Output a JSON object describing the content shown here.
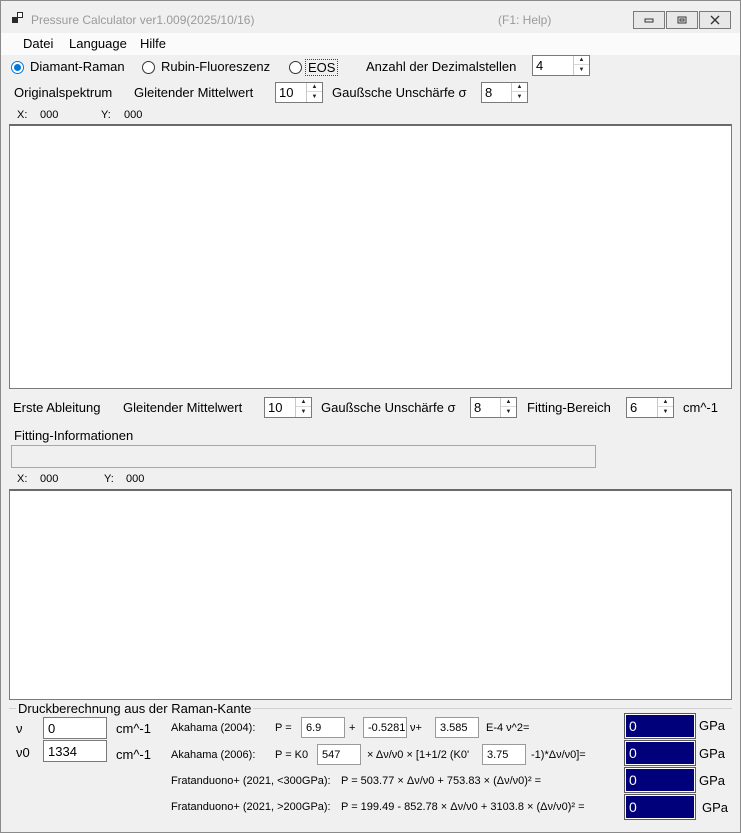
{
  "window": {
    "title": "Pressure Calculator  ver1.009(2025/10/16)",
    "help_hint": "(F1: Help)"
  },
  "menu": {
    "items": [
      "Datei",
      "Language",
      "Hilfe"
    ]
  },
  "mode": {
    "options": [
      "Diamant-Raman",
      "Rubin-Fluoreszenz",
      "EOS"
    ],
    "selected": "Diamant-Raman",
    "decimals_label": "Anzahl der Dezimalstellen",
    "decimals_value": "4"
  },
  "original": {
    "label": "Originalspektrum",
    "moving_avg_label": "Gleitender Mittelwert",
    "moving_avg_value": "10",
    "gauss_label": "Gaußsche Unschärfe σ",
    "gauss_value": "8",
    "x_label": "X:",
    "x_value": "000",
    "y_label": "Y:",
    "y_value": "000"
  },
  "derivative": {
    "label": "Erste Ableitung",
    "moving_avg_label": "Gleitender Mittelwert",
    "moving_avg_value": "10",
    "gauss_label": "Gaußsche Unschärfe σ",
    "gauss_value": "8",
    "fit_range_label": "Fitting-Bereich",
    "fit_range_value": "6",
    "fit_range_unit": "cm^-1",
    "fit_info_label": "Fitting-Informationen",
    "fit_info_value": "",
    "x_label": "X:",
    "x_value": "000",
    "y_label": "Y:",
    "y_value": "000"
  },
  "pressure": {
    "group_title": "Druckberechnung aus der Raman-Kante",
    "nu_label": "ν",
    "nu_value": "0",
    "nu_unit": "cm^-1",
    "nu0_label": "ν0",
    "nu0_value": "1334",
    "nu0_unit": "cm^-1",
    "akahama2004": {
      "name": "Akahama (2004):",
      "p_eq": "P =",
      "a": "6.9",
      "plus1": "+",
      "b": "-0.5281",
      "nu_plus": "ν+",
      "c": "3.585",
      "tail": "E-4 ν^2=",
      "result": "0",
      "unit": "GPa"
    },
    "akahama2006": {
      "name": "Akahama (2006):",
      "p_eq": "P = K0",
      "k0": "547",
      "mid": "× Δν/ν0 × [1+1/2 (K0'",
      "k0p": "3.75",
      "tail": "-1)*Δν/ν0]=",
      "result": "0",
      "unit": "GPa"
    },
    "fratanduono_low": {
      "name": "Fratanduono+ (2021, <300GPa):",
      "formula": "P = 503.77 × Δν/ν0 + 753.83 × (Δν/ν0)² =",
      "result": "0",
      "unit": "GPa"
    },
    "fratanduono_high": {
      "name": "Fratanduono+ (2021, >200GPa):",
      "formula": "P = 199.49 - 852.78 × Δν/ν0 + 3103.8 × (Δν/ν0)² =",
      "result": "0",
      "unit": "GPa"
    }
  }
}
